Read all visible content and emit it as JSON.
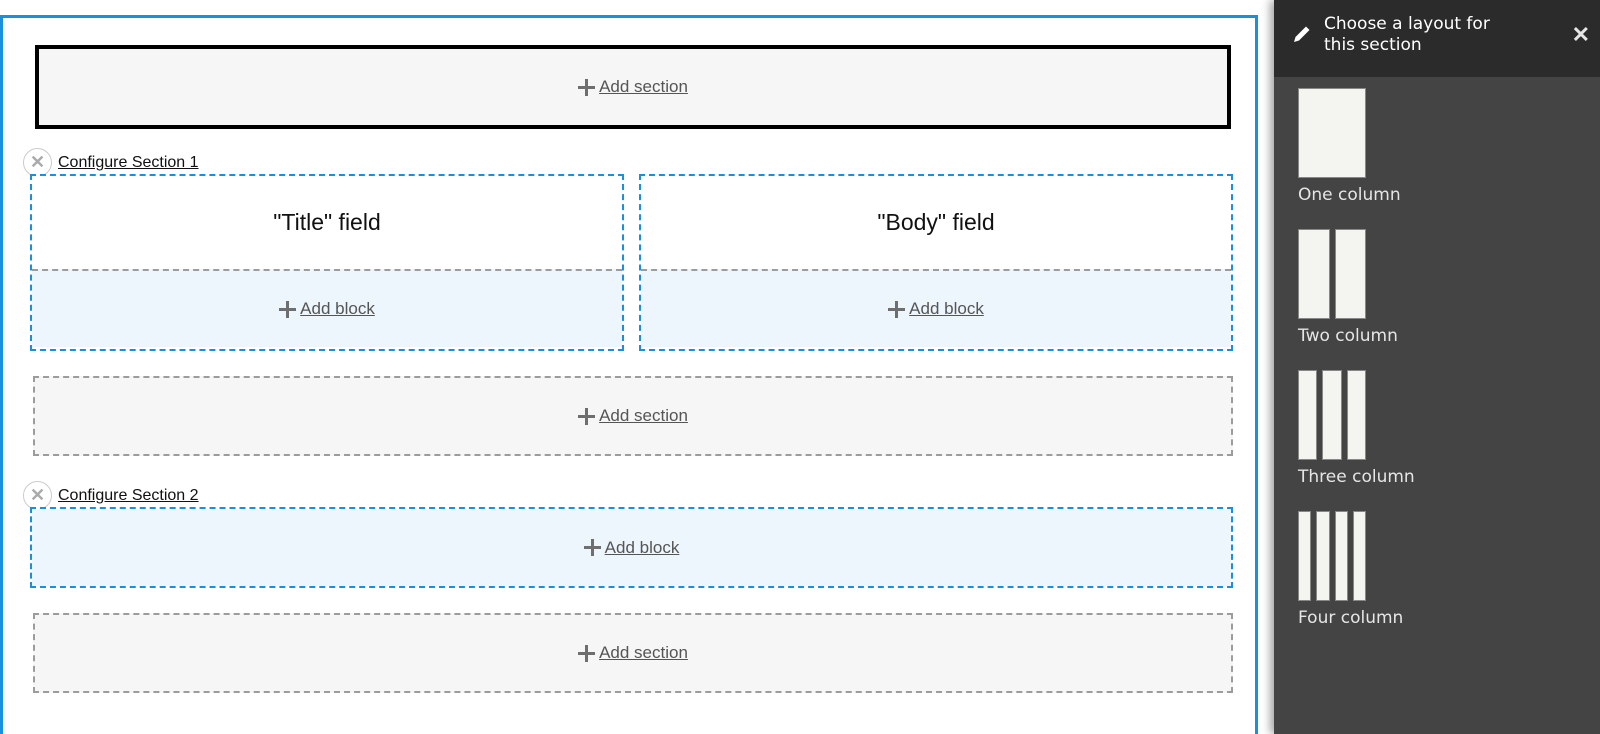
{
  "main": {
    "add_section_label": "Add section",
    "add_block_label": "Add block",
    "sections": [
      {
        "configure_label": "Configure Section 1",
        "remove_icon": "close-icon",
        "regions": [
          {
            "field_label": "\"Title\" field",
            "add_block_label": "Add block"
          },
          {
            "field_label": "\"Body\" field",
            "add_block_label": "Add block"
          }
        ]
      },
      {
        "configure_label": "Configure Section 2",
        "remove_icon": "close-icon",
        "regions": [
          {
            "add_block_label": "Add block"
          }
        ]
      }
    ],
    "accent_color": "#1a8fdc"
  },
  "off_canvas": {
    "title": "Choose a layout for this section",
    "header_icon": "pencil-icon",
    "close_icon": "close-icon",
    "layouts": [
      {
        "label": "One column",
        "columns": 1
      },
      {
        "label": "Two column",
        "columns": 2
      },
      {
        "label": "Three column",
        "columns": 3
      },
      {
        "label": "Four column",
        "columns": 4
      }
    ]
  }
}
